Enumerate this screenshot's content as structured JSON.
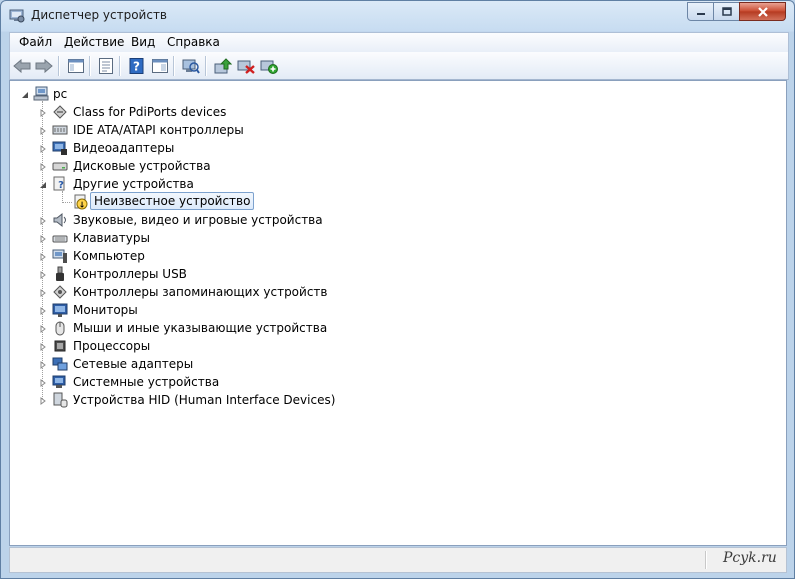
{
  "window": {
    "title": "Диспетчер устройств",
    "icon": "device-manager-icon"
  },
  "title_controls": {
    "minimize_icon": "minimize-icon",
    "maximize_icon": "maximize-icon",
    "close_icon": "close-icon"
  },
  "menu": {
    "items": [
      {
        "label": "Файл"
      },
      {
        "label": "Действие"
      },
      {
        "label": "Вид"
      },
      {
        "label": "Справка"
      }
    ]
  },
  "toolbar": {
    "buttons": [
      {
        "name": "back-icon"
      },
      {
        "name": "forward-icon"
      },
      {
        "name": "show-hide-console-tree-icon"
      },
      {
        "name": "properties-icon"
      },
      {
        "name": "help-icon"
      },
      {
        "name": "action-pane-icon"
      },
      {
        "name": "scan-hardware-icon"
      },
      {
        "name": "update-driver-icon"
      },
      {
        "name": "uninstall-icon"
      },
      {
        "name": "add-legacy-hardware-icon"
      }
    ]
  },
  "tree": {
    "root": {
      "label": "pc",
      "icon": "computer-icon",
      "expanded": true
    },
    "nodes": [
      {
        "label": "Class for PdiPorts devices",
        "icon": "network-port-icon",
        "expanded": false
      },
      {
        "label": "IDE ATA/ATAPI контроллеры",
        "icon": "ide-controller-icon",
        "expanded": false
      },
      {
        "label": "Видеоадаптеры",
        "icon": "display-adapter-icon",
        "expanded": false
      },
      {
        "label": "Дисковые устройства",
        "icon": "disk-drive-icon",
        "expanded": false
      },
      {
        "label": "Другие устройства",
        "icon": "other-devices-icon",
        "expanded": true,
        "children": [
          {
            "label": "Неизвестное устройство",
            "icon": "unknown-device-icon",
            "selected": true
          }
        ]
      },
      {
        "label": "Звуковые, видео и игровые устройства",
        "icon": "speaker-icon",
        "expanded": false
      },
      {
        "label": "Клавиатуры",
        "icon": "keyboard-icon",
        "expanded": false
      },
      {
        "label": "Компьютер",
        "icon": "computer-icon",
        "expanded": false
      },
      {
        "label": "Контроллеры USB",
        "icon": "usb-icon",
        "expanded": false
      },
      {
        "label": "Контроллеры запоминающих устройств",
        "icon": "storage-controller-icon",
        "expanded": false
      },
      {
        "label": "Мониторы",
        "icon": "monitor-icon",
        "expanded": false
      },
      {
        "label": "Мыши и иные указывающие устройства",
        "icon": "mouse-icon",
        "expanded": false
      },
      {
        "label": "Процессоры",
        "icon": "processor-icon",
        "expanded": false
      },
      {
        "label": "Сетевые адаптеры",
        "icon": "network-adapter-icon",
        "expanded": false
      },
      {
        "label": "Системные устройства",
        "icon": "system-devices-icon",
        "expanded": false
      },
      {
        "label": "Устройства HID (Human Interface Devices)",
        "icon": "hid-icon",
        "expanded": false
      }
    ]
  },
  "statusbar": {
    "watermark": "Pcyk.ru"
  },
  "colors": {
    "selection_border": "#7da2ce",
    "selection_fill": "#dceafb",
    "close_button": "#c8492e"
  }
}
